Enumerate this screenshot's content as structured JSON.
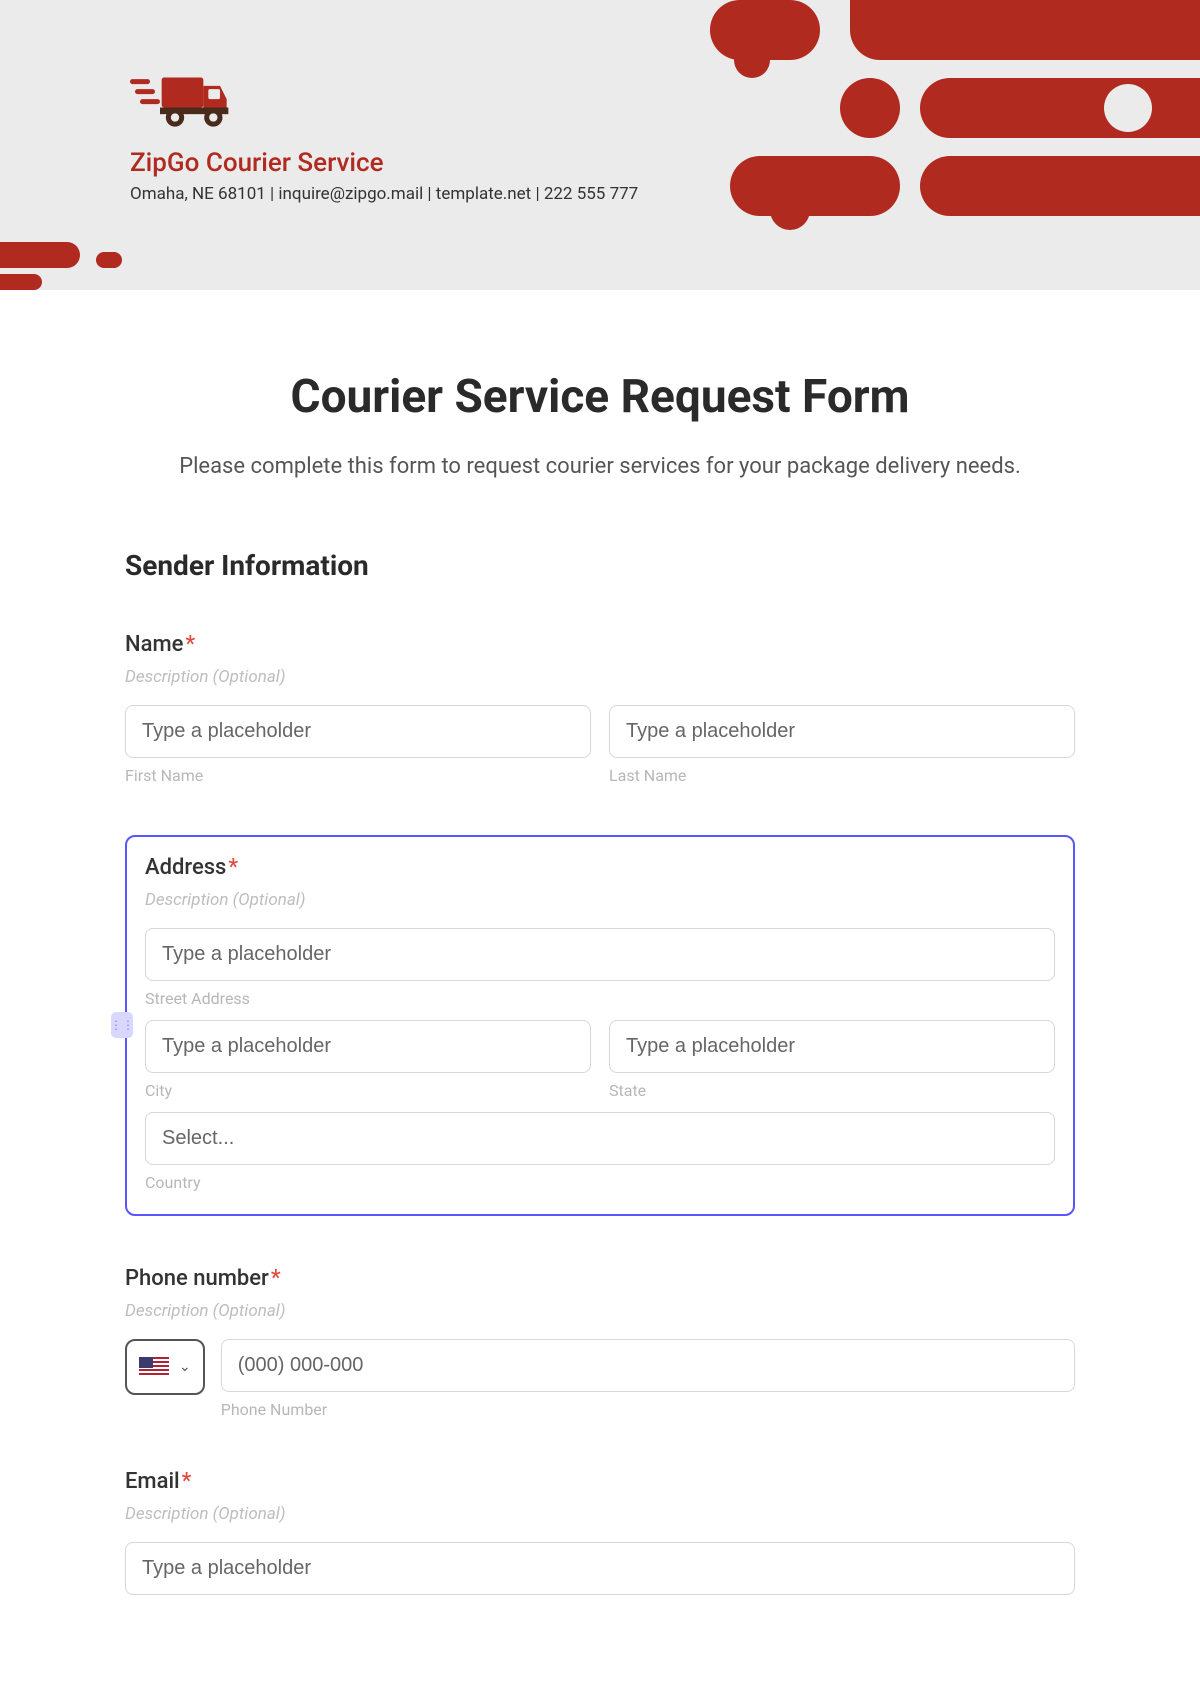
{
  "header": {
    "company_name": "ZipGo Courier Service",
    "company_meta": "Omaha, NE 68101 | inquire@zipgo.mail | template.net | 222 555 777"
  },
  "form": {
    "title": "Courier Service Request Form",
    "subtitle": "Please complete this form to request courier services for your package delivery needs.",
    "section_sender": "Sender Information",
    "desc_optional": "Description (Optional)",
    "name": {
      "label": "Name",
      "first_placeholder": "Type a placeholder",
      "first_sub": "First Name",
      "last_placeholder": "Type a placeholder",
      "last_sub": "Last Name"
    },
    "address": {
      "label": "Address",
      "street_placeholder": "Type a placeholder",
      "street_sub": "Street Address",
      "city_placeholder": "Type a placeholder",
      "city_sub": "City",
      "state_placeholder": "Type a placeholder",
      "state_sub": "State",
      "country_placeholder": "Select...",
      "country_sub": "Country"
    },
    "phone": {
      "label": "Phone number",
      "placeholder": "(000) 000-000",
      "sub": "Phone Number"
    },
    "email": {
      "label": "Email",
      "placeholder": "Type a placeholder"
    }
  }
}
